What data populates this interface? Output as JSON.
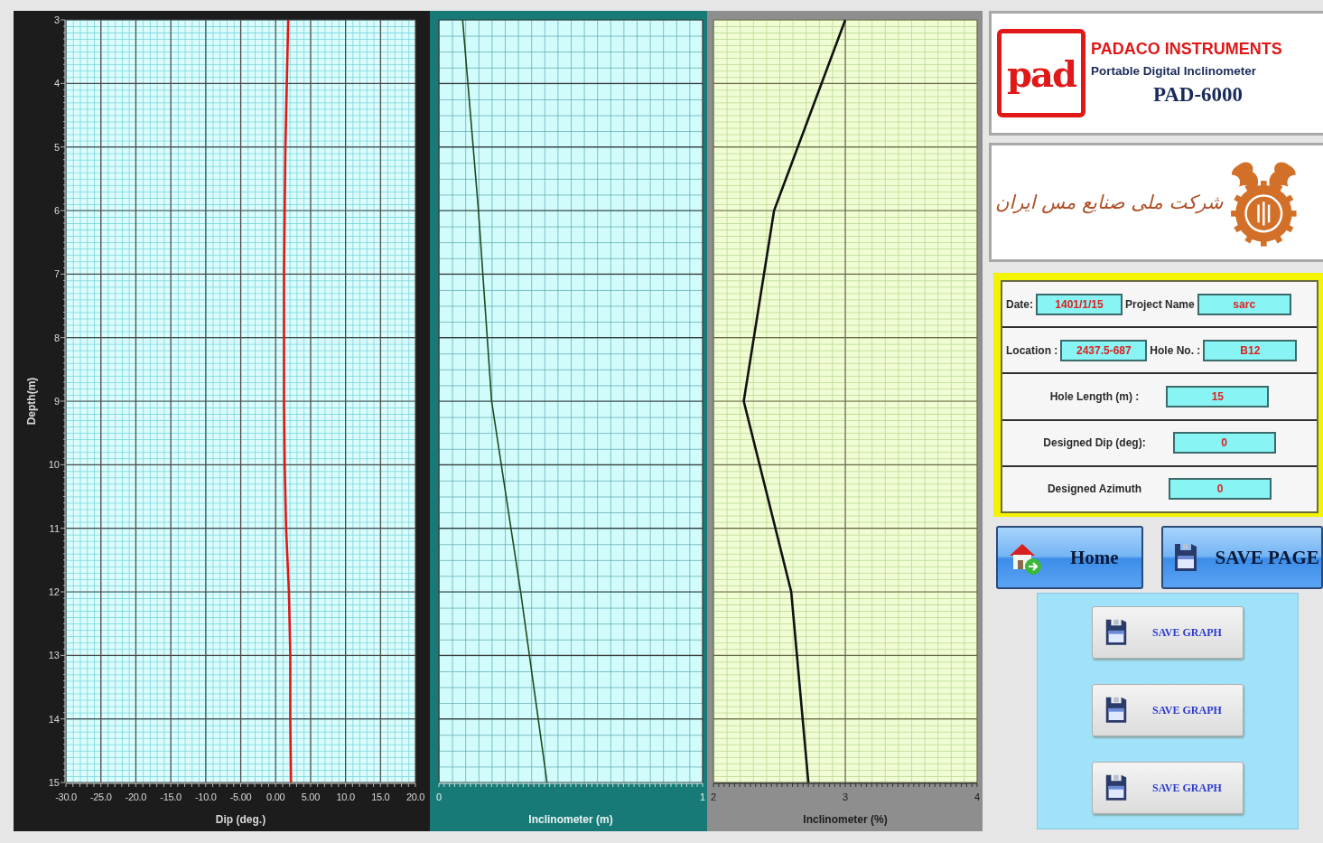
{
  "charts": [
    {
      "kind": "dip",
      "chart_data": {
        "type": "line",
        "xlabel": "Dip (deg.)",
        "ylabel": "Depth(m)",
        "x": [
          1.8,
          1.6,
          1.4,
          1.3,
          1.2,
          1.2,
          1.2,
          1.3,
          1.5,
          1.9,
          2.1,
          2.1,
          2.2
        ],
        "grid": true,
        "series": [
          {
            "color": "#e01818",
            "values": [
              3,
              4,
              5,
              6,
              7,
              8,
              9,
              10,
              11,
              12,
              13,
              14,
              15
            ]
          }
        ],
        "xlim": [
          -30,
          20
        ],
        "ylim": [
          15,
          3
        ],
        "xticks": [
          {
            "value": -30,
            "label": "-30.0"
          },
          {
            "value": -25,
            "label": "-25.0"
          },
          {
            "value": -20,
            "label": "-20.0"
          },
          {
            "value": -15,
            "label": "-15.0"
          },
          {
            "value": -10,
            "label": "-10.0"
          },
          {
            "value": -5,
            "label": "-5.00"
          },
          {
            "value": 0,
            "label": "0.00"
          },
          {
            "value": 5,
            "label": "5.00"
          },
          {
            "value": 10,
            "label": "10.0"
          },
          {
            "value": 15,
            "label": "15.0"
          },
          {
            "value": 20,
            "label": "20.0"
          }
        ],
        "yticks": [
          3,
          4,
          5,
          6,
          7,
          8,
          9,
          10,
          11,
          12,
          13,
          14,
          15
        ]
      }
    },
    {
      "kind": "meters",
      "chart_data": {
        "type": "line",
        "xlabel": "Inclinometer (m)",
        "x": [
          0.09,
          0.15,
          0.2,
          0.31,
          0.41
        ],
        "grid": true,
        "series": [
          {
            "color": "#1d4a1d",
            "values": [
              3,
              6,
              9,
              12,
              15
            ]
          }
        ],
        "xlim": [
          0,
          1
        ],
        "ylim": [
          15,
          3
        ],
        "xticks": [
          0,
          1
        ]
      }
    },
    {
      "kind": "percent",
      "chart_data": {
        "type": "line",
        "xlabel": "Inclinometer (%)",
        "x": [
          3.0,
          2.46,
          2.23,
          2.59,
          2.72
        ],
        "grid": true,
        "series": [
          {
            "color": "#111111",
            "values": [
              3,
              6,
              9,
              12,
              15
            ]
          }
        ],
        "xlim": [
          2,
          4
        ],
        "ylim": [
          15,
          3
        ],
        "xticks": [
          2,
          3,
          4
        ]
      }
    }
  ],
  "header": {
    "logo_text": "pad",
    "brand": "PADACO INSTRUMENTS",
    "product": "Portable Digital Inclinometer",
    "model": "PAD-6000"
  },
  "company": {
    "name": "شرکت ملی صنایع مس ایران"
  },
  "form": {
    "rows": [
      {
        "fields": [
          {
            "label": "Date:",
            "value": "1401/1/15"
          },
          {
            "label": "Project Name",
            "value": "sarc"
          }
        ]
      },
      {
        "fields": [
          {
            "label": "Location :",
            "value": "2437.5-687"
          },
          {
            "label": "Hole No. :",
            "value": "B12"
          }
        ]
      },
      {
        "fields": [
          {
            "label": "Hole Length (m) :",
            "value": "15"
          }
        ]
      },
      {
        "fields": [
          {
            "label": "Designed Dip (deg):",
            "value": "0"
          }
        ]
      },
      {
        "fields": [
          {
            "label": "Designed Azimuth",
            "value": "0"
          }
        ]
      }
    ]
  },
  "nav_buttons": [
    {
      "kind": "home",
      "label": "Home"
    },
    {
      "kind": "save",
      "label": "SAVE PAGE"
    }
  ],
  "graph_buttons": [
    {
      "label": "SAVE GRAPH"
    },
    {
      "label": "SAVE GRAPH"
    },
    {
      "label": "SAVE GRAPH"
    }
  ]
}
